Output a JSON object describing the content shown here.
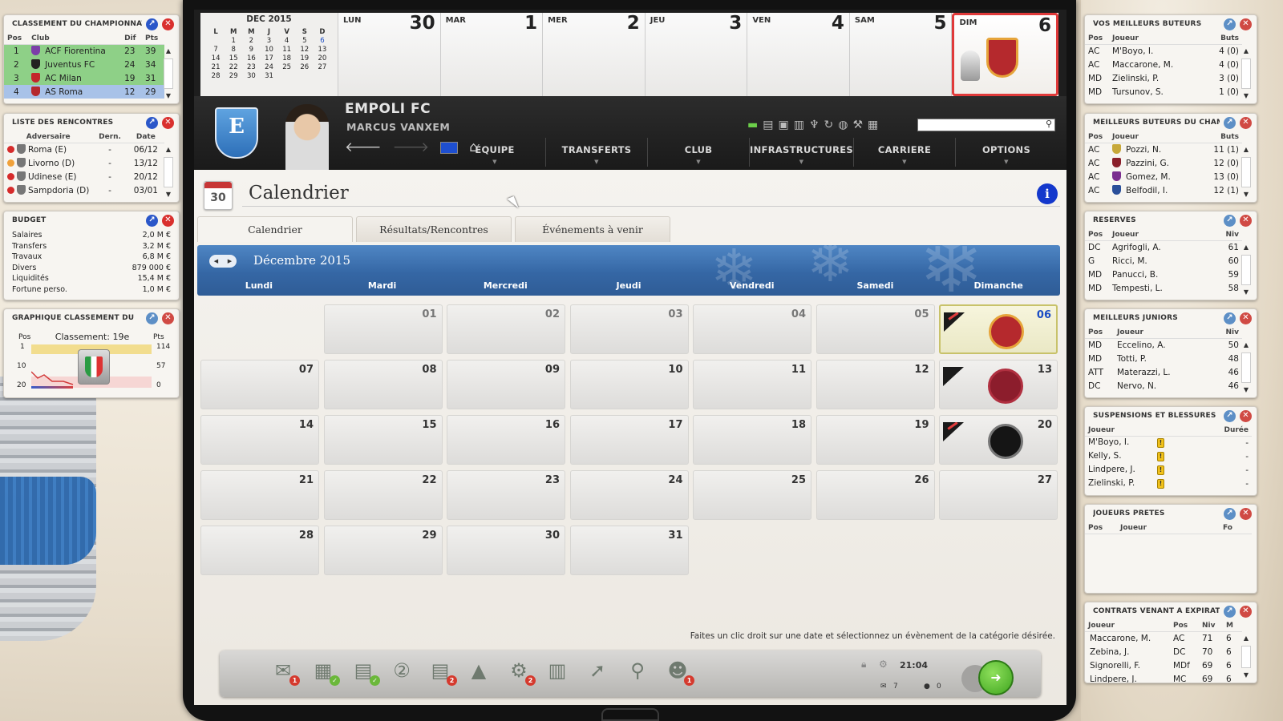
{
  "standings": {
    "title": "CLASSEMENT DU CHAMPIONNAT",
    "cols": [
      "Pos",
      "Club",
      "Dif",
      "Pts"
    ],
    "rows": [
      {
        "pos": "1",
        "club": "ACF Fiorentina",
        "dif": "23",
        "pts": "39",
        "color": "#7c3fa8"
      },
      {
        "pos": "2",
        "club": "Juventus FC",
        "dif": "24",
        "pts": "34",
        "color": "#222222"
      },
      {
        "pos": "3",
        "club": "AC Milan",
        "dif": "19",
        "pts": "31",
        "color": "#c3262b"
      },
      {
        "pos": "4",
        "club": "AS Roma",
        "dif": "12",
        "pts": "29",
        "color": "#b5292d"
      }
    ]
  },
  "fixtures": {
    "title": "LISTE DES RENCONTRES",
    "cols": [
      "Adversaire",
      "Dern.",
      "Date"
    ],
    "rows": [
      {
        "opp": "Roma (E)",
        "last": "-",
        "date": "06/12",
        "dot": "#d62b2b"
      },
      {
        "opp": "Livorno (D)",
        "last": "-",
        "date": "13/12",
        "dot": "#f0a13a"
      },
      {
        "opp": "Udinese (E)",
        "last": "-",
        "date": "20/12",
        "dot": "#d62b2b"
      },
      {
        "opp": "Sampdoria (D)",
        "last": "-",
        "date": "03/01",
        "dot": "#d62b2b"
      }
    ]
  },
  "budget": {
    "title": "BUDGET",
    "rows": [
      {
        "k": "Salaires",
        "v": "2,0 M €"
      },
      {
        "k": "Transfers",
        "v": "3,2 M €"
      },
      {
        "k": "Travaux",
        "v": "6,8 M €"
      },
      {
        "k": "Divers",
        "v": "879 000 €"
      },
      {
        "k": "Liquidités",
        "v": "15,4 M €"
      },
      {
        "k": "Fortune perso.",
        "v": "1,0 M €"
      }
    ]
  },
  "graph": {
    "title": "GRAPHIQUE CLASSEMENT DU",
    "pos_label": "Pos",
    "pts_label": "Pts",
    "ranking": "Classement: 19e",
    "y_left": [
      "1",
      "10",
      "20"
    ],
    "y_right": [
      "114",
      "57",
      "0"
    ]
  },
  "scorers": {
    "title": "VOS MEILLEURS BUTEURS",
    "cols": [
      "Pos",
      "Joueur",
      "Buts"
    ],
    "rows": [
      [
        "AC",
        "M'Boyo, I.",
        "4 (0)"
      ],
      [
        "AC",
        "Maccarone, M.",
        "4 (0)"
      ],
      [
        "MD",
        "Zielinski, P.",
        "3 (0)"
      ],
      [
        "MD",
        "Tursunov, S.",
        "1 (0)"
      ]
    ]
  },
  "league_scorers": {
    "title": "MEILLEURS BUTEURS DU CHAMP.",
    "cols": [
      "Pos",
      "Joueur",
      "Buts"
    ],
    "rows": [
      [
        "AC",
        "Pozzi, N.",
        "11 (1)"
      ],
      [
        "AC",
        "Pazzini, G.",
        "12 (0)"
      ],
      [
        "AC",
        "Gomez, M.",
        "13 (0)"
      ],
      [
        "AC",
        "Belfodil, I.",
        "12 (1)"
      ]
    ]
  },
  "reserves": {
    "title": "RÉSERVES",
    "cols": [
      "Pos",
      "Joueur",
      "Niv"
    ],
    "rows": [
      [
        "DC",
        "Agrifogli, A.",
        "61"
      ],
      [
        "G",
        "Ricci, M.",
        "60"
      ],
      [
        "MD",
        "Panucci, B.",
        "59"
      ],
      [
        "MD",
        "Tempesti, L.",
        "58"
      ]
    ]
  },
  "juniors": {
    "title": "MEILLEURS JUNIORS",
    "cols": [
      "Pos",
      "Joueur",
      "Niv"
    ],
    "rows": [
      [
        "MD",
        "Eccelino, A.",
        "50"
      ],
      [
        "MD",
        "Totti, P.",
        "48"
      ],
      [
        "ATT",
        "Materazzi, L.",
        "46"
      ],
      [
        "DC",
        "Nervo, N.",
        "46"
      ]
    ]
  },
  "injuries": {
    "title": "SUSPENSIONS ET BLESSURES",
    "cols": [
      "Joueur",
      "Durée"
    ],
    "rows": [
      [
        "M'Boyo, I.",
        "-"
      ],
      [
        "Kelly, S.",
        "-"
      ],
      [
        "Lindpere, J.",
        "-"
      ],
      [
        "Zielinski, P.",
        "-"
      ]
    ]
  },
  "loaned": {
    "title": "JOUEURS PRÊTÉS",
    "cols": [
      "Pos",
      "Joueur",
      "Fo"
    ]
  },
  "contracts": {
    "title": "CONTRATS VENANT A EXPIRATION",
    "cols": [
      "Joueur",
      "Pos",
      "Niv",
      "M"
    ],
    "rows": [
      [
        "Maccarone, M.",
        "AC",
        "71",
        "6"
      ],
      [
        "Zebina, J.",
        "DC",
        "70",
        "6"
      ],
      [
        "Signorelli, F.",
        "MDf",
        "69",
        "6"
      ],
      [
        "Lindpere, J.",
        "MC",
        "69",
        "6"
      ]
    ]
  },
  "minical": {
    "title": "DEC 2015",
    "dow": [
      "L",
      "M",
      "M",
      "J",
      "V",
      "S",
      "D"
    ],
    "weeks": [
      [
        "",
        "1",
        "2",
        "3",
        "4",
        "5",
        "6"
      ],
      [
        "7",
        "8",
        "9",
        "10",
        "11",
        "12",
        "13"
      ],
      [
        "14",
        "15",
        "16",
        "17",
        "18",
        "19",
        "20"
      ],
      [
        "21",
        "22",
        "23",
        "24",
        "25",
        "26",
        "27"
      ],
      [
        "28",
        "29",
        "30",
        "31",
        "",
        "",
        ""
      ]
    ]
  },
  "week": [
    {
      "d": "LUN",
      "n": "30"
    },
    {
      "d": "MAR",
      "n": "1"
    },
    {
      "d": "MER",
      "n": "2"
    },
    {
      "d": "JEU",
      "n": "3"
    },
    {
      "d": "VEN",
      "n": "4"
    },
    {
      "d": "SAM",
      "n": "5"
    },
    {
      "d": "DIM",
      "n": "6"
    }
  ],
  "header": {
    "club": "EMPOLI FC",
    "manager": "MARCUS VANXEM",
    "crest_letter": "E",
    "menu": [
      "ÉQUIPE",
      "TRANSFERTS",
      "CLUB",
      "INFRASTRUCTURES",
      "CARRIERE",
      "OPTIONS"
    ]
  },
  "page": {
    "title": "Calendrier",
    "calendar_icon_num": "30",
    "info": "i",
    "tabs": [
      "Calendrier",
      "Résultats/Rencontres",
      "Événements à venir"
    ],
    "month": "Décembre 2015",
    "dow": [
      "Lundi",
      "Mardi",
      "Mercredi",
      "Jeudi",
      "Vendredi",
      "Samedi",
      "Dimanche"
    ],
    "hint": "Faites un clic droit sur une date et sélectionnez un évènement de la catégorie désirée."
  },
  "grid": [
    [
      null,
      "01",
      "02",
      "03",
      "04",
      "05",
      "06"
    ],
    [
      "07",
      "08",
      "09",
      "10",
      "11",
      "12",
      "13"
    ],
    [
      "14",
      "15",
      "16",
      "17",
      "18",
      "19",
      "20"
    ],
    [
      "21",
      "22",
      "23",
      "24",
      "25",
      "26",
      "27"
    ],
    [
      "28",
      "29",
      "30",
      "31",
      null,
      null,
      null
    ]
  ],
  "matches": {
    "06": {
      "opp": "AS Roma",
      "color": "#b5292d",
      "ring": "#e6a43a"
    },
    "13": {
      "opp": "Livorno",
      "color": "#8c1d2c",
      "ring": "#b03040"
    },
    "20": {
      "opp": "Udinese",
      "color": "#151515",
      "ring": "#777777"
    }
  },
  "dock": {
    "time": "21:04",
    "mail_count": "7",
    "msg_count": "0",
    "items": [
      {
        "icon": "mail-icon",
        "g": "✉",
        "badge": "1"
      },
      {
        "icon": "calendar-icon",
        "g": "▦",
        "badge": "✓",
        "ok": true
      },
      {
        "icon": "tactics-icon",
        "g": "▤",
        "badge": "✓",
        "ok": true
      },
      {
        "icon": "squad-icon",
        "g": "②",
        "badge": ""
      },
      {
        "icon": "training-icon",
        "g": "▤",
        "badge": "2"
      },
      {
        "icon": "cone-icon",
        "g": "▲",
        "badge": ""
      },
      {
        "icon": "scout-icon",
        "g": "⚙",
        "badge": "2"
      },
      {
        "icon": "documents-icon",
        "g": "▥",
        "badge": ""
      },
      {
        "icon": "transfer-icon",
        "g": "➚",
        "badge": ""
      },
      {
        "icon": "search-icon",
        "g": "⚲",
        "badge": ""
      },
      {
        "icon": "staff-icon",
        "g": "☻",
        "badge": "1"
      }
    ]
  }
}
